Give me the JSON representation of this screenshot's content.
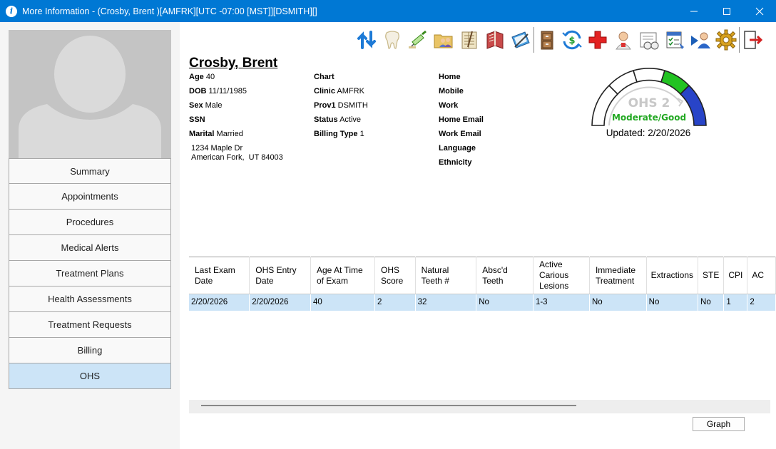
{
  "window": {
    "title": "More Information - (Crosby, Brent )[AMFRK][UTC -07:00 [MST]][DSMITH][]",
    "app_icon": "info-icon"
  },
  "toolbar": {
    "icons": [
      "refresh-arrows-icon",
      "tooth-icon",
      "syringe-icon",
      "folder-people-icon",
      "ledger-icon",
      "book-icon",
      "notebook-pen-icon",
      "file-cabinet-icon",
      "dollar-refresh-icon",
      "red-cross-icon",
      "person-card-icon",
      "paper-chart-icon",
      "checklist-icon",
      "person-arrow-icon",
      "gear-icon",
      "exit-door-icon"
    ]
  },
  "sidebar": {
    "items": [
      {
        "label": "Summary"
      },
      {
        "label": "Appointments"
      },
      {
        "label": "Procedures"
      },
      {
        "label": "Medical Alerts"
      },
      {
        "label": "Treatment Plans"
      },
      {
        "label": "Health Assessments"
      },
      {
        "label": "Treatment Requests"
      },
      {
        "label": "Billing"
      },
      {
        "label": "OHS",
        "active": true
      }
    ]
  },
  "patient": {
    "name": "Crosby, Brent",
    "col1": [
      {
        "label": "Age",
        "value": "40"
      },
      {
        "label": "DOB",
        "value": "11/11/1985"
      },
      {
        "label": "Sex",
        "value": "Male"
      },
      {
        "label": "SSN",
        "value": ""
      },
      {
        "label": "Marital",
        "value": "Married"
      }
    ],
    "address_line1": "1234 Maple Dr",
    "address_line2": "American Fork,  UT 84003",
    "col2": [
      {
        "label": "Chart",
        "value": ""
      },
      {
        "label": "Clinic",
        "value": "AMFRK"
      },
      {
        "label": "Prov1",
        "value": "DSMITH"
      },
      {
        "label": "Status",
        "value": "Active"
      },
      {
        "label": "Billing Type",
        "value": "1"
      }
    ],
    "col3": [
      {
        "label": "Home",
        "value": ""
      },
      {
        "label": "Mobile",
        "value": ""
      },
      {
        "label": "Work",
        "value": ""
      },
      {
        "label": "Home Email",
        "value": ""
      },
      {
        "label": "Work Email",
        "value": ""
      },
      {
        "label": "Language",
        "value": ""
      },
      {
        "label": "Ethnicity",
        "value": ""
      }
    ]
  },
  "gauge": {
    "title": "OHS 2",
    "status": "Moderate/Good",
    "updated": "Updated: 2/20/2026",
    "colors": {
      "green": "#22c322",
      "blue": "#2844c8",
      "status_text": "#22a822",
      "title_text": "#c8c8c8"
    }
  },
  "ohs_table": {
    "columns": [
      "Last Exam Date",
      "OHS Entry Date",
      "Age At Time of Exam",
      "OHS Score",
      "Natural Teeth #",
      "Absc'd Teeth",
      "Active Carious Lesions",
      "Immediate Treatment",
      "Extractions",
      "STE",
      "CPI",
      "AC"
    ],
    "rows": [
      [
        "2/20/2026",
        "2/20/2026",
        "40",
        "2",
        "32",
        "No",
        "1-3",
        "No",
        "No",
        "No",
        "1",
        "2"
      ]
    ]
  },
  "graph_button": "Graph"
}
